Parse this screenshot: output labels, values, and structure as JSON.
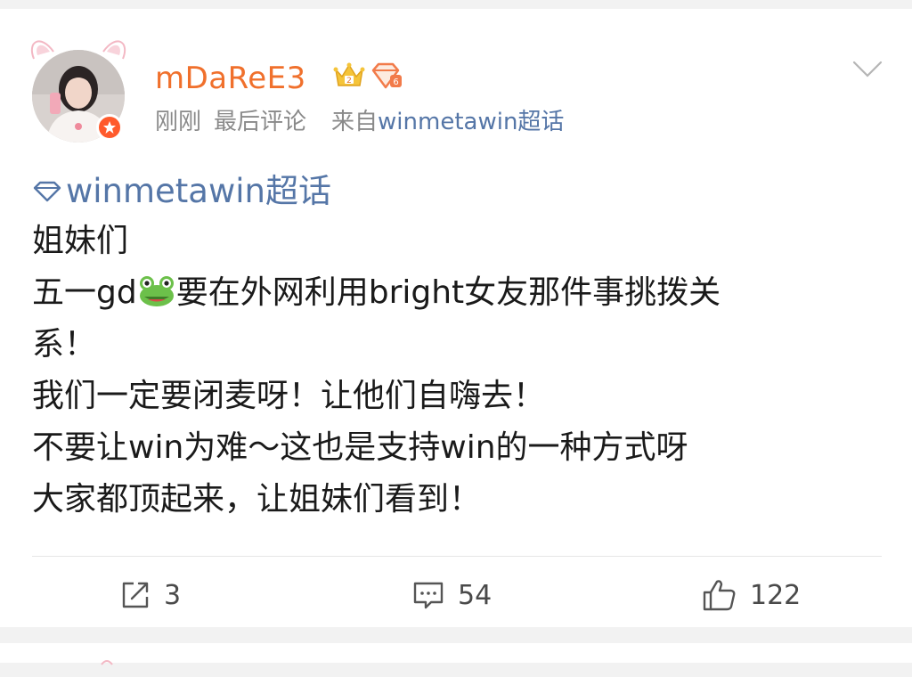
{
  "post": {
    "username": "mDaReE3",
    "meta": {
      "time": "刚刚",
      "status": "最后评论",
      "source_prefix": "来自",
      "source": "winmetawin超话"
    },
    "topic": "winmetawin超话",
    "lines": [
      "姐妹们",
      "五一gd",
      "要在外网利用bright女友那件事挑拨关",
      "系！",
      "我们一定要闭麦呀！让他们自嗨去！",
      "不要让win为难～这也是支持win的一种方式呀",
      "大家都顶起来，让姐妹们看到！"
    ],
    "actions": {
      "reposts": "3",
      "comments": "54",
      "likes": "122"
    }
  },
  "icons": {
    "rank": "crown-rank-icon",
    "level": "diamond-level-icon",
    "topic": "diamond-topic-icon",
    "chevron": "chevron-down-icon"
  },
  "colors": {
    "username": "#f0702c",
    "link": "#5576a7",
    "text": "#1a1a1a",
    "meta": "#8a8a8a"
  }
}
